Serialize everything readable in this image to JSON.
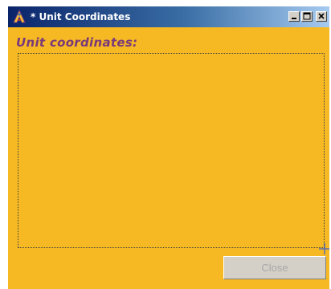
{
  "window": {
    "title": "* Unit Coordinates",
    "icon": "app-logo-icon",
    "controls": {
      "minimize_icon": "minimize-icon",
      "maximize_icon": "maximize-icon",
      "close_icon": "close-icon"
    }
  },
  "content": {
    "heading": "Unit coordinates:",
    "text_area_value": ""
  },
  "buttons": {
    "close_label": "Close"
  },
  "colors": {
    "background": "#f6b923",
    "heading": "#7a3a7a",
    "titlebar_start": "#0a246a",
    "titlebar_end": "#a6caf0",
    "disabled_text": "#a8a8a8"
  }
}
